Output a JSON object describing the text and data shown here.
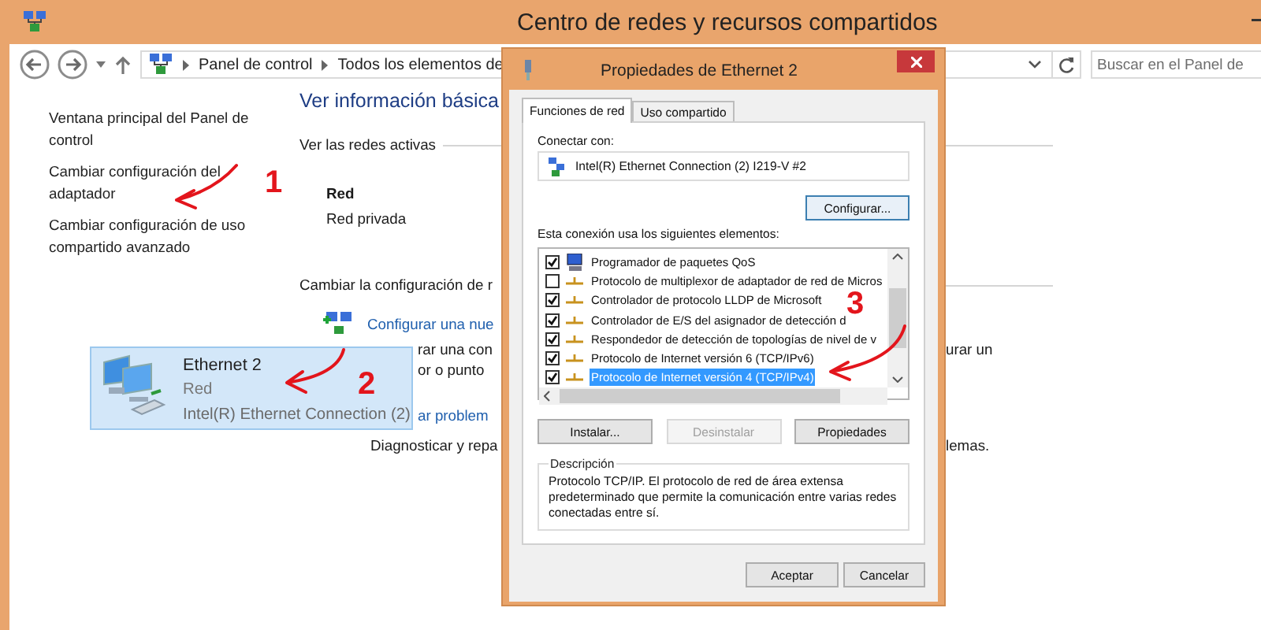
{
  "window": {
    "title": "Centro de redes y recursos compartidos"
  },
  "address_bar": {
    "crumbs": [
      "Panel de control",
      "Todos los elementos de"
    ]
  },
  "search": {
    "placeholder": "Buscar en el Panel de"
  },
  "sidebar": {
    "items": [
      "Ventana principal del Panel de control",
      "Cambiar configuración del adaptador",
      "Cambiar configuración de uso compartido avanzado"
    ]
  },
  "main": {
    "heading": "Ver información básica",
    "active_networks_label": "Ver las redes activas",
    "network": {
      "name": "Red",
      "type": "Red privada"
    },
    "change_label": "Cambiar la configuración de r",
    "tasks": [
      {
        "kind": "link",
        "text": "Configurar una nue"
      },
      {
        "kind": "text",
        "text": "rar una con",
        "right": "urar un"
      },
      {
        "kind": "text",
        "text": "or o punto"
      },
      {
        "kind": "link",
        "text": "ar problem"
      },
      {
        "kind": "text",
        "text": "Diagnosticar y repa",
        "right": "lemas."
      }
    ]
  },
  "adapter_tile": {
    "name": "Ethernet 2",
    "network": "Red",
    "device": "Intel(R) Ethernet Connection (2)",
    "selected": true
  },
  "dialog": {
    "title": "Propiedades de Ethernet 2",
    "tabs": [
      {
        "label": "Funciones de red",
        "selected": true
      },
      {
        "label": "Uso compartido",
        "selected": false
      }
    ],
    "connect_label": "Conectar con:",
    "adapter": "Intel(R) Ethernet Connection (2) I219-V #2",
    "configure_button": "Configurar...",
    "items_label": "Esta conexión usa los siguientes elementos:",
    "items": [
      {
        "kind": "scheduler",
        "label": "Programador de paquetes QoS",
        "checked": true,
        "selected": false
      },
      {
        "kind": "protocol",
        "label": "Protocolo de multiplexor de adaptador de red de Micros",
        "checked": false,
        "selected": false
      },
      {
        "kind": "protocol",
        "label": "Controlador de protocolo LLDP de Microsoft",
        "checked": true,
        "selected": false
      },
      {
        "kind": "protocol",
        "label": "Controlador de E/S del asignador de detección d",
        "checked": true,
        "selected": false
      },
      {
        "kind": "protocol",
        "label": "Respondedor de detección de topologías de nivel de v",
        "checked": true,
        "selected": false
      },
      {
        "kind": "protocol",
        "label": "Protocolo de Internet versión 6 (TCP/IPv6)",
        "checked": true,
        "selected": false
      },
      {
        "kind": "protocol",
        "label": "Protocolo de Internet versión 4 (TCP/IPv4)",
        "checked": true,
        "selected": true
      }
    ],
    "buttons": [
      {
        "label": "Instalar...",
        "disabled": false
      },
      {
        "label": "Desinstalar",
        "disabled": true
      },
      {
        "label": "Propiedades",
        "disabled": false
      }
    ],
    "description": {
      "title": "Descripción",
      "text": "Protocolo TCP/IP. El protocolo de red de área extensa predeterminado que permite la comunicación entre varias redes conectadas entre sí."
    },
    "footer_buttons": [
      "Aceptar",
      "Cancelar"
    ]
  },
  "annotations": [
    {
      "label": "1"
    },
    {
      "label": "2"
    },
    {
      "label": "3"
    }
  ]
}
